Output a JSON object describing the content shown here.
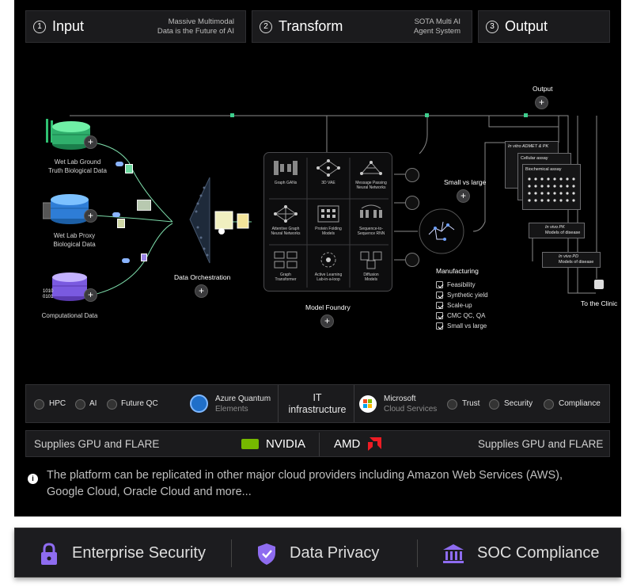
{
  "steps": [
    {
      "num": "1",
      "title": "Input",
      "sub_line1": "Massive Multimodal",
      "sub_line2": "Data is the Future of AI"
    },
    {
      "num": "2",
      "title": "Transform",
      "sub_line1": "SOTA Multi AI",
      "sub_line2": "Agent System"
    },
    {
      "num": "3",
      "title": "Output"
    }
  ],
  "inputs": {
    "wet_lab_ground_l1": "Wet Lab Ground",
    "wet_lab_ground_l2": "Truth Biological Data",
    "wet_lab_proxy_l1": "Wet Lab Proxy",
    "wet_lab_proxy_l2": "Biological Data",
    "computational": "Computational Data",
    "binary_l1": "1010",
    "binary_l2": "0101"
  },
  "data_orchestration": "Data Orchestration",
  "plus_symbol": "+",
  "model_foundry": {
    "label": "Model Foundry",
    "cells": [
      {
        "l1": "Graph GANs",
        "l2": ""
      },
      {
        "l1": "3D VAE",
        "l2": ""
      },
      {
        "l1": "Message Passing",
        "l2": "Neural Networks"
      },
      {
        "l1": "Attentive Graph",
        "l2": "Neural Networks"
      },
      {
        "l1": "Protein Folding",
        "l2": "Models"
      },
      {
        "l1": "Sequence-to-",
        "l2": "Sequence RNN"
      },
      {
        "l1": "Graph",
        "l2": "Transformer"
      },
      {
        "l1": "Active Learning",
        "l2": "Lab-in-a-loop"
      },
      {
        "l1": "Diffusion",
        "l2": "Models"
      }
    ]
  },
  "small_vs_large": "Small vs large",
  "manufacturing": {
    "title": "Manufacturing",
    "items": [
      "Feasibility",
      "Synthetic yield",
      "Scale-up",
      "CMC QC, QA",
      "Small vs large"
    ]
  },
  "output_label": "Output",
  "lab_cards": {
    "admet": "In vitro ADMET & PK",
    "cellular": "Cellular assay",
    "biochemical": "Biochemical assay",
    "pk_l1": "In vivo PK",
    "pk_l2": "Models of disease",
    "pd_l1": "In vivo PD",
    "pd_l2": "Models of disease"
  },
  "to_clinic": "To the Clinic",
  "infra": {
    "hpc": "HPC",
    "ai": "AI",
    "future_qc": "Future QC",
    "azure_l1": "Azure Quantum",
    "azure_l2": "Elements",
    "it_l1": "IT",
    "it_l2": "infrastructure",
    "ms_l1": "Microsoft",
    "ms_l2": "Cloud Services",
    "trust": "Trust",
    "security": "Security",
    "compliance": "Compliance"
  },
  "gpu_bar": {
    "left": "Supplies GPU and FLARE",
    "nvidia": "NVIDIA",
    "amd": "AMD",
    "right": "Supplies GPU and FLARE"
  },
  "note": "The platform can be replicated in other major cloud providers including Amazon Web Services (AWS), Google Cloud, Oracle Cloud and more...",
  "banner": {
    "items": [
      "Enterprise Security",
      "Data Privacy",
      "SOC Compliance"
    ]
  },
  "colors": {
    "accent_green": "#3ecf8e",
    "nvidia_green": "#76b900",
    "amd_red": "#ed1c24",
    "banner_purple": "#8e6cf0"
  }
}
